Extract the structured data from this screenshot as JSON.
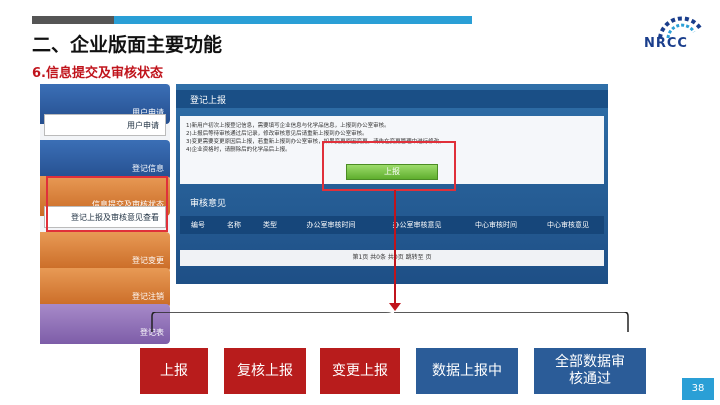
{
  "header": {
    "title": "二、企业版面主要功能",
    "subtitle": "6.信息提交及审核状态",
    "logo_text": "NRCC",
    "page_number": "38"
  },
  "sidebar": {
    "items": [
      {
        "label": "用户申请"
      },
      {
        "label": "用户申请"
      },
      {
        "label": "登记信息"
      },
      {
        "label": "信息提交及审核状态"
      },
      {
        "label": "登记上报及审核意见查看"
      },
      {
        "label": "登记变更"
      },
      {
        "label": "登记注销"
      },
      {
        "label": "登记表"
      }
    ]
  },
  "app": {
    "section_title": "登记上报",
    "notice_lines": [
      "1)新用户初次上报登记信息，需要填写企业信息与化学品信息，上报到办公室审核。",
      "2)上报后等待审核通过后记录，修改审核意见后请重新上报到办公室审核。",
      "3)变更需要变更原因后上报，若重新上报到办公室审核，如果变更原因变更，请先在变更管理中进行修改。",
      "4)企业资格时，请删除后的化学品后上报。"
    ],
    "report_button": "上报",
    "audit_title": "审核意见",
    "table_headers": [
      "编号",
      "名称",
      "类型",
      "办公室审核时间",
      "办公室审核意见",
      "中心审核时间",
      "中心审核意见"
    ],
    "pager_text": "第1页 共0条 共0页 跳转至  页"
  },
  "statuses": [
    {
      "label": "上报"
    },
    {
      "label": "复核上报"
    },
    {
      "label": "变更上报"
    },
    {
      "label": "数据上报中"
    },
    {
      "label": "全部数据审核通过"
    }
  ],
  "colors": {
    "accent_red": "#c0141c",
    "accent_blue": "#2a9fd6",
    "status_red": "#b81c1c",
    "status_blue": "#2b5c98"
  }
}
